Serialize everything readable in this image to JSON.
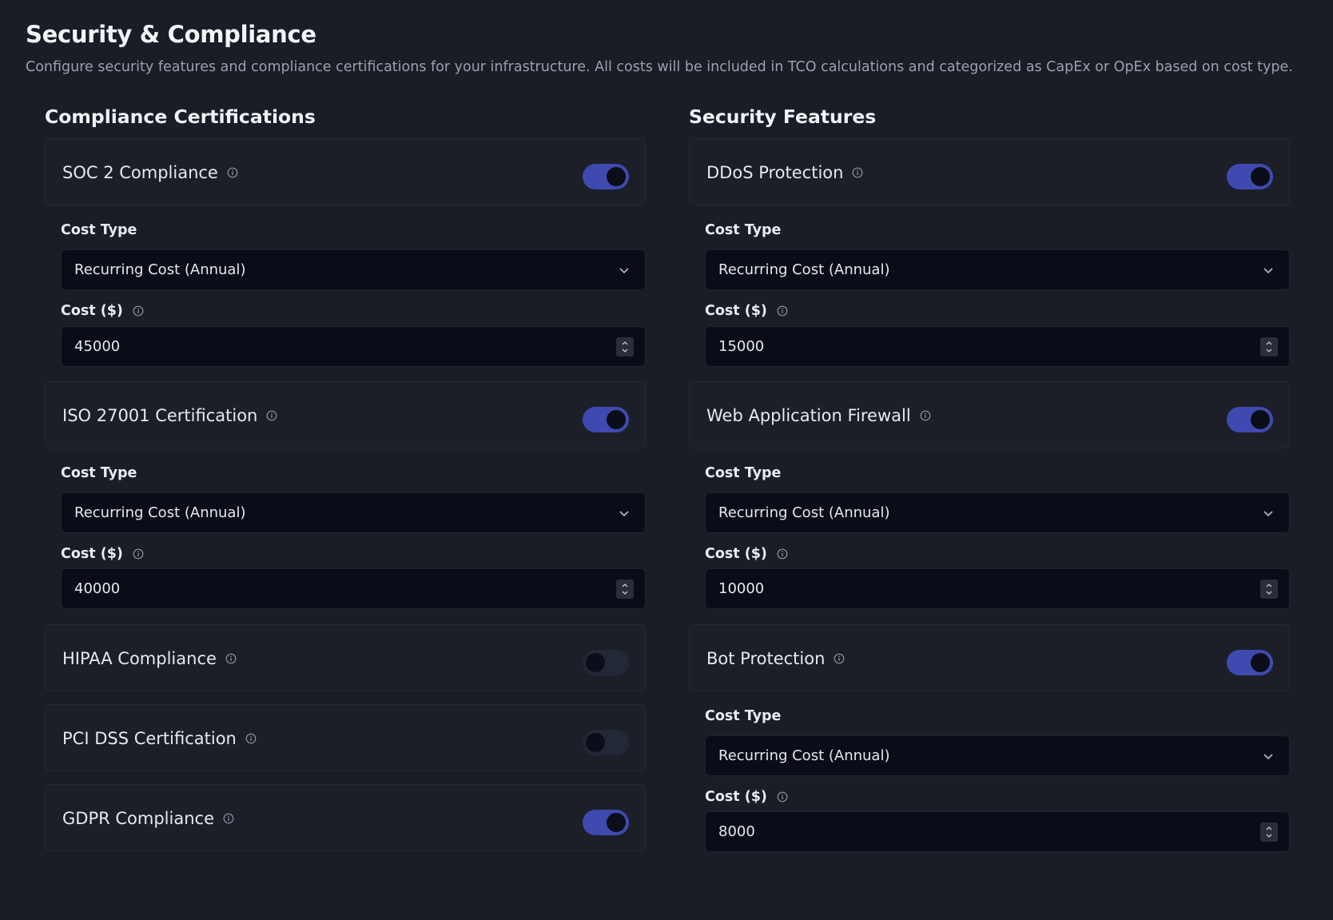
{
  "header": {
    "title": "Security & Compliance",
    "description": "Configure security features and compliance certifications for your infrastructure. All costs will be included in TCO calculations and categorized as CapEx or OpEx based on cost type."
  },
  "compliance": {
    "title": "Compliance Certifications",
    "items": [
      {
        "label": "SOC 2 Compliance",
        "enabled": true,
        "cost_type_label": "Cost Type",
        "cost_type": "Recurring Cost (Annual)",
        "cost_label": "Cost ($)",
        "cost": "45000"
      },
      {
        "label": "ISO 27001 Certification",
        "enabled": true,
        "cost_type_label": "Cost Type",
        "cost_type": "Recurring Cost (Annual)",
        "cost_label": "Cost ($)",
        "cost": "40000"
      },
      {
        "label": "HIPAA Compliance",
        "enabled": false
      },
      {
        "label": "PCI DSS Certification",
        "enabled": false
      },
      {
        "label": "GDPR Compliance",
        "enabled": true
      }
    ]
  },
  "security": {
    "title": "Security Features",
    "items": [
      {
        "label": "DDoS Protection",
        "enabled": true,
        "cost_type_label": "Cost Type",
        "cost_type": "Recurring Cost (Annual)",
        "cost_label": "Cost ($)",
        "cost": "15000"
      },
      {
        "label": "Web Application Firewall",
        "enabled": true,
        "cost_type_label": "Cost Type",
        "cost_type": "Recurring Cost (Annual)",
        "cost_label": "Cost ($)",
        "cost": "10000"
      },
      {
        "label": "Bot Protection",
        "enabled": true,
        "cost_type_label": "Cost Type",
        "cost_type": "Recurring Cost (Annual)",
        "cost_label": "Cost ($)",
        "cost": "8000"
      }
    ]
  },
  "colors": {
    "background": "#1a1d26",
    "toggle_on": "#3f4ab0",
    "toggle_off": "#232837",
    "input_bg": "#0a0d17"
  },
  "icons": {
    "info": "info-circle-icon",
    "select": "chevron-down-icon",
    "number": "spinner-updown-icon"
  }
}
